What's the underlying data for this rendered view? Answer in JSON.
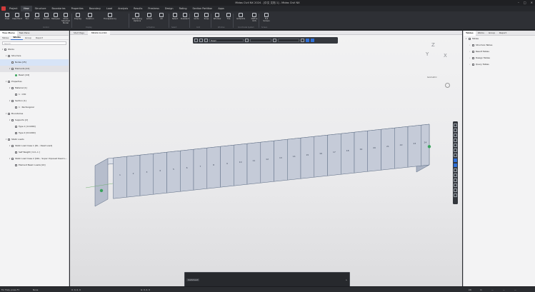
{
  "window": {
    "title": "Midas Civil NX 2024 - [中文 文档 1] - Midas Civil NX",
    "controls": [
      "–",
      "□",
      "✕"
    ]
  },
  "menu": {
    "items": [
      "Project",
      "View",
      "Structure",
      "Boundaries",
      "Properties",
      "Boundary",
      "Load",
      "Analysis",
      "Results",
      "Prestress",
      "Design",
      "Rating",
      "Section Partition",
      "Apps"
    ],
    "active_index": 1
  },
  "ribbon": {
    "buttons": [
      {
        "label": "View",
        "icon": "view-icon"
      },
      {
        "label": "View Point",
        "icon": "viewpoint-icon"
      },
      {
        "label": "Pan",
        "icon": "pan-icon"
      },
      {
        "label": "Zoom",
        "icon": "zoom-icon"
      },
      {
        "label": "Rotate",
        "icon": "rotate-icon"
      },
      {
        "label": "Marquee",
        "icon": "marquee-icon"
      },
      {
        "label": "Show Selected Model",
        "icon": "show-selected-icon"
      },
      {
        "label": "Display",
        "icon": "display-icon"
      },
      {
        "label": "Relation",
        "icon": "relation-icon"
      },
      {
        "label": "Transparency",
        "icon": "transparency-icon"
      },
      {
        "label": "Rendering Options",
        "icon": "rendering-icon"
      },
      {
        "label": "Active",
        "icon": "active-icon"
      },
      {
        "label": "All",
        "icon": "all-icon"
      },
      {
        "label": "Select",
        "icon": "select-icon"
      },
      {
        "label": "Deselect",
        "icon": "deselect-icon"
      },
      {
        "label": "Grids",
        "icon": "grids-icon"
      },
      {
        "label": "Snap",
        "icon": "snap-icon"
      },
      {
        "label": "Window",
        "icon": "window-icon"
      },
      {
        "label": "Tile",
        "icon": "tile-icon"
      },
      {
        "label": "GCS/UCS",
        "icon": "ucs-icon"
      },
      {
        "label": "Define UCS",
        "icon": "define-ucs-icon"
      },
      {
        "label": "Full Screen",
        "icon": "fullscreen-icon"
      }
    ],
    "groups": [
      "Control",
      "Display",
      "Activation",
      "Select",
      "Grid",
      "Window",
      "Coordinate System",
      "Screen"
    ]
  },
  "left_panel": {
    "tabs": [
      "Tree Menu",
      "Task Pane"
    ],
    "active_tab": 0,
    "subtabs": [
      "Tables",
      "Works",
      "Group",
      "Report"
    ],
    "active_subtab": 1,
    "search_placeholder": "Search",
    "tree": [
      {
        "label": "Works",
        "level": 0,
        "arrow": "▾"
      },
      {
        "label": "Structure",
        "level": 1,
        "arrow": "▾"
      },
      {
        "label": "Nodes [25]",
        "level": 2,
        "arrow": "",
        "selected": "blue"
      },
      {
        "label": "Elements [24]",
        "level": 2,
        "arrow": "▾",
        "selected": "grey"
      },
      {
        "label": "Beam [24]",
        "level": 3,
        "arrow": "",
        "icon": "green"
      },
      {
        "label": "Properties",
        "level": 1,
        "arrow": "▾"
      },
      {
        "label": "Material [1]",
        "level": 2,
        "arrow": "▾"
      },
      {
        "label": "1 : C30",
        "level": 3,
        "arrow": ""
      },
      {
        "label": "Section [1]",
        "level": 2,
        "arrow": "▾"
      },
      {
        "label": "1 : Rectangular",
        "level": 3,
        "arrow": ""
      },
      {
        "label": "Boundaries",
        "level": 1,
        "arrow": "▾"
      },
      {
        "label": "Supports [2]",
        "level": 2,
        "arrow": "▾"
      },
      {
        "label": "Type 1 [111000]",
        "level": 3,
        "arrow": ""
      },
      {
        "label": "Type 2 [011000]",
        "level": 3,
        "arrow": ""
      },
      {
        "label": "Static Loads",
        "level": 1,
        "arrow": "▾"
      },
      {
        "label": "Static Load Case 1 [DL ; Dead Load]",
        "level": 2,
        "arrow": "▾"
      },
      {
        "label": "Self Weight [ 0,0,-1 ]",
        "level": 3,
        "arrow": ""
      },
      {
        "label": "Static Load Case 2 [SDL ; Super Imposed Dead L...",
        "level": 2,
        "arrow": "▾"
      },
      {
        "label": "Element Beam Loads [24]",
        "level": 3,
        "arrow": ""
      }
    ]
  },
  "viewport": {
    "tabs": [
      "Start Page",
      "MIDAS Civil NX"
    ],
    "active_tab": 1,
    "toolbar": {
      "view_dropdown": "Beam",
      "dropdown2": "",
      "dropdown3": ""
    },
    "view_label": "Isometric",
    "axis": {
      "z": "Z",
      "y": "Y",
      "x": "X"
    },
    "element_numbers": [
      "1",
      "2",
      "3",
      "4",
      "5",
      "6",
      "7",
      "8",
      "9",
      "10",
      "11",
      "12",
      "13",
      "14",
      "15",
      "16",
      "17",
      "18",
      "19",
      "20",
      "21",
      "22",
      "23",
      "24"
    ],
    "command_label": "Command",
    "beam_color": "#c5cbd8",
    "edge_color": "#5a6a82",
    "node_color": "#3aa45c"
  },
  "right_panel": {
    "tabs": [
      "Tables",
      "Works",
      "Group",
      "Report"
    ],
    "active_tab": 0,
    "tree": [
      {
        "label": "Tables",
        "arrow": "▾"
      },
      {
        "label": "Structure Tables",
        "arrow": "›"
      },
      {
        "label": "Result Tables",
        "arrow": "›"
      },
      {
        "label": "Design Tables",
        "arrow": "›"
      },
      {
        "label": "Query Tables",
        "arrow": "›"
      }
    ]
  },
  "status": {
    "help": "For Help, press F1",
    "mode": "None",
    "coord1": "U: 0, 0, 0",
    "coord2": "G: 0, 0, 0",
    "units": [
      "kN",
      "m",
      "—",
      "—",
      "—"
    ]
  }
}
